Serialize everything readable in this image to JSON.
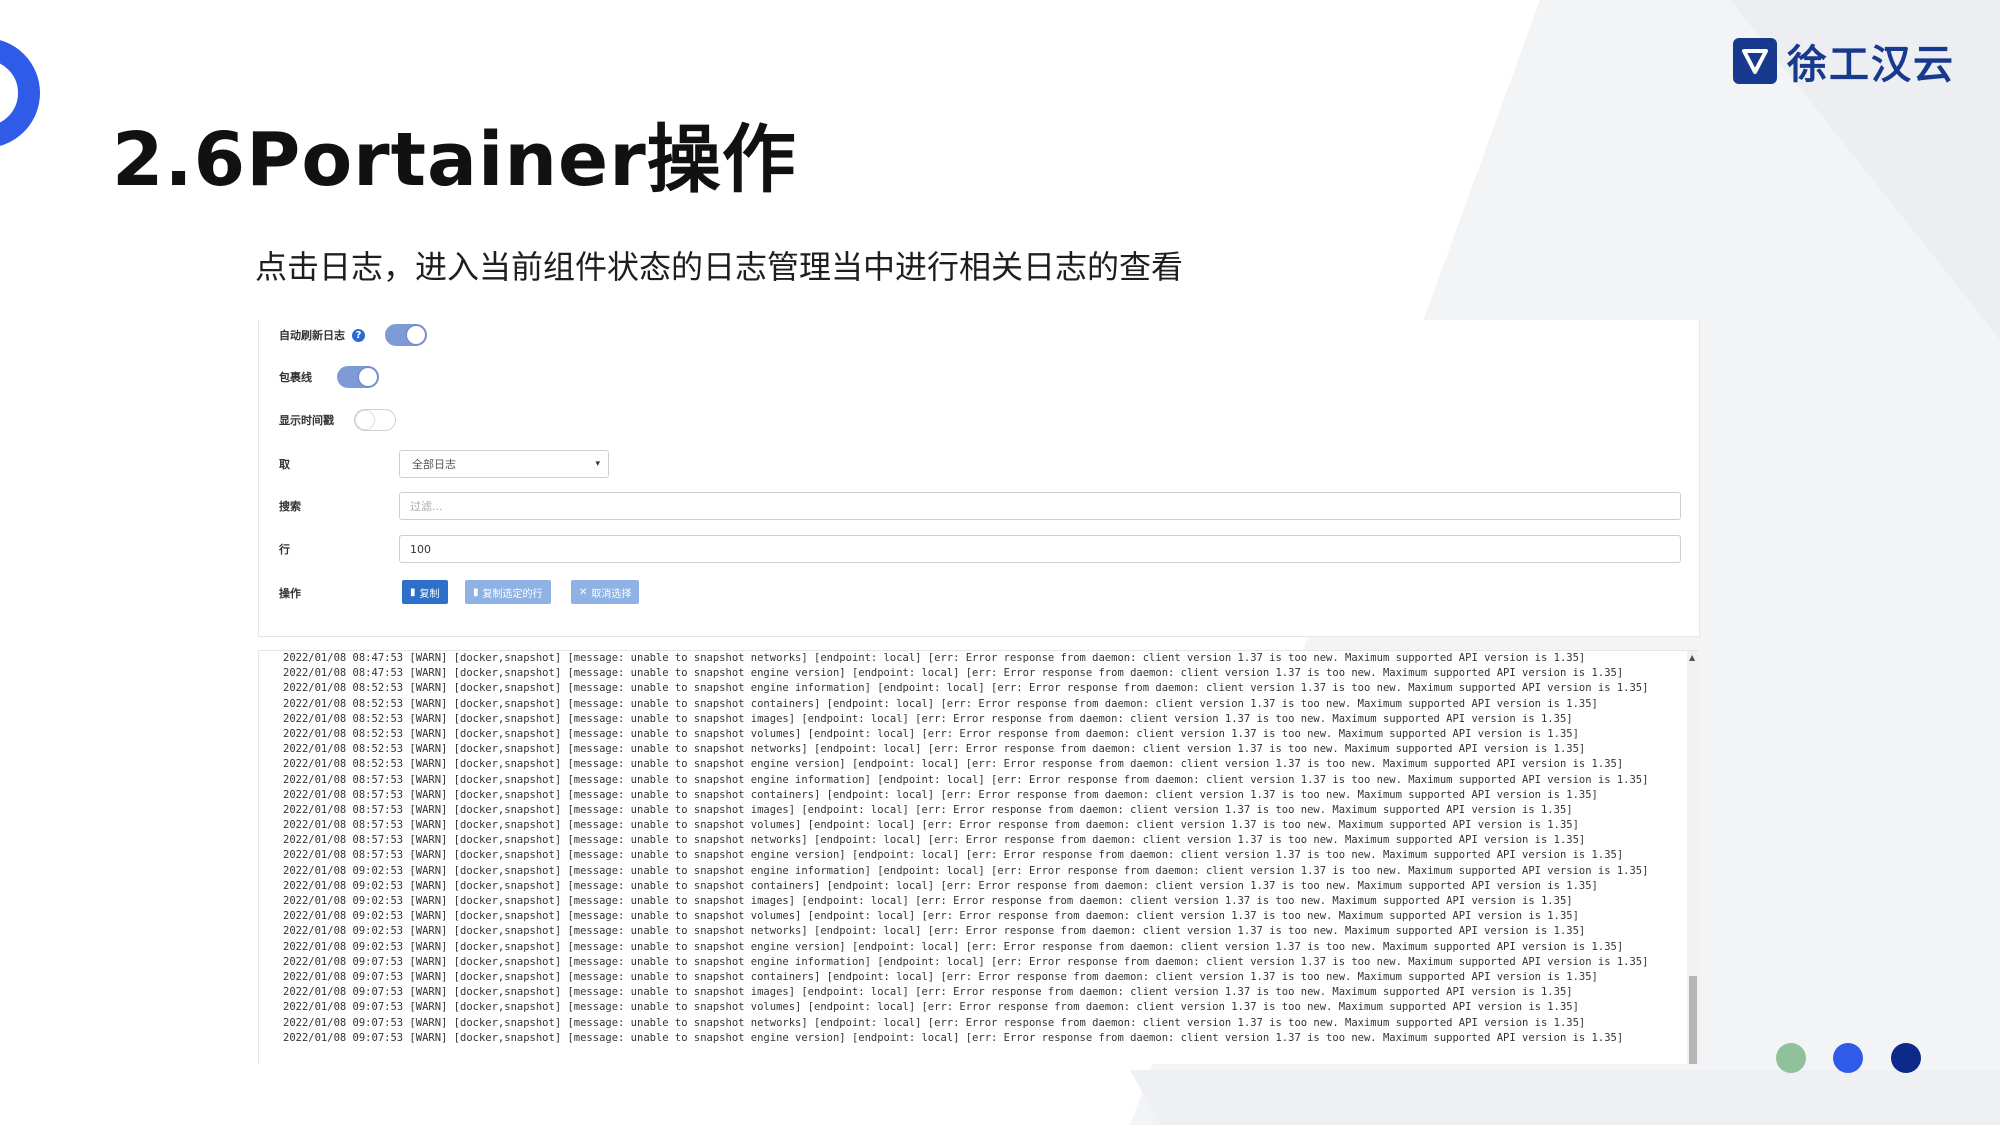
{
  "slide": {
    "title": "2.6Portainer操作",
    "subtitle": "点击日志，进入当前组件状态的日志管理当中进行相关日志的查看",
    "logo_text": "徐工汉云"
  },
  "colors": {
    "accent_blue": "#2f5be8",
    "logo_navy": "#173a8e",
    "dot_green": "#8fc29a",
    "dot_blue": "#2f5be8",
    "dot_navy": "#0d2a8a"
  },
  "form": {
    "auto_refresh_label": "自动刷新日志",
    "auto_refresh_on": true,
    "wrap_label": "包裹线",
    "wrap_on": true,
    "timestamp_label": "显示时间戳",
    "timestamp_on": false,
    "fetch_label": "取",
    "fetch_value": "全部日志",
    "search_label": "搜索",
    "search_placeholder": "过滤...",
    "lines_label": "行",
    "lines_value": "100",
    "actions_label": "操作",
    "copy_button": "复制",
    "copy_selected_button": "复制选定的行",
    "unselect_button": "取消选择"
  },
  "log_lines": [
    "2022/01/08 08:47:53 [WARN] [docker,snapshot] [message: unable to snapshot networks] [endpoint: local] [err: Error response from daemon: client version 1.37 is too new. Maximum supported API version is 1.35]",
    "2022/01/08 08:47:53 [WARN] [docker,snapshot] [message: unable to snapshot engine version] [endpoint: local] [err: Error response from daemon: client version 1.37 is too new. Maximum supported API version is 1.35]",
    "2022/01/08 08:52:53 [WARN] [docker,snapshot] [message: unable to snapshot engine information] [endpoint: local] [err: Error response from daemon: client version 1.37 is too new. Maximum supported API version is 1.35]",
    "2022/01/08 08:52:53 [WARN] [docker,snapshot] [message: unable to snapshot containers] [endpoint: local] [err: Error response from daemon: client version 1.37 is too new. Maximum supported API version is 1.35]",
    "2022/01/08 08:52:53 [WARN] [docker,snapshot] [message: unable to snapshot images] [endpoint: local] [err: Error response from daemon: client version 1.37 is too new. Maximum supported API version is 1.35]",
    "2022/01/08 08:52:53 [WARN] [docker,snapshot] [message: unable to snapshot volumes] [endpoint: local] [err: Error response from daemon: client version 1.37 is too new. Maximum supported API version is 1.35]",
    "2022/01/08 08:52:53 [WARN] [docker,snapshot] [message: unable to snapshot networks] [endpoint: local] [err: Error response from daemon: client version 1.37 is too new. Maximum supported API version is 1.35]",
    "2022/01/08 08:52:53 [WARN] [docker,snapshot] [message: unable to snapshot engine version] [endpoint: local] [err: Error response from daemon: client version 1.37 is too new. Maximum supported API version is 1.35]",
    "2022/01/08 08:57:53 [WARN] [docker,snapshot] [message: unable to snapshot engine information] [endpoint: local] [err: Error response from daemon: client version 1.37 is too new. Maximum supported API version is 1.35]",
    "2022/01/08 08:57:53 [WARN] [docker,snapshot] [message: unable to snapshot containers] [endpoint: local] [err: Error response from daemon: client version 1.37 is too new. Maximum supported API version is 1.35]",
    "2022/01/08 08:57:53 [WARN] [docker,snapshot] [message: unable to snapshot images] [endpoint: local] [err: Error response from daemon: client version 1.37 is too new. Maximum supported API version is 1.35]",
    "2022/01/08 08:57:53 [WARN] [docker,snapshot] [message: unable to snapshot volumes] [endpoint: local] [err: Error response from daemon: client version 1.37 is too new. Maximum supported API version is 1.35]",
    "2022/01/08 08:57:53 [WARN] [docker,snapshot] [message: unable to snapshot networks] [endpoint: local] [err: Error response from daemon: client version 1.37 is too new. Maximum supported API version is 1.35]",
    "2022/01/08 08:57:53 [WARN] [docker,snapshot] [message: unable to snapshot engine version] [endpoint: local] [err: Error response from daemon: client version 1.37 is too new. Maximum supported API version is 1.35]",
    "2022/01/08 09:02:53 [WARN] [docker,snapshot] [message: unable to snapshot engine information] [endpoint: local] [err: Error response from daemon: client version 1.37 is too new. Maximum supported API version is 1.35]",
    "2022/01/08 09:02:53 [WARN] [docker,snapshot] [message: unable to snapshot containers] [endpoint: local] [err: Error response from daemon: client version 1.37 is too new. Maximum supported API version is 1.35]",
    "2022/01/08 09:02:53 [WARN] [docker,snapshot] [message: unable to snapshot images] [endpoint: local] [err: Error response from daemon: client version 1.37 is too new. Maximum supported API version is 1.35]",
    "2022/01/08 09:02:53 [WARN] [docker,snapshot] [message: unable to snapshot volumes] [endpoint: local] [err: Error response from daemon: client version 1.37 is too new. Maximum supported API version is 1.35]",
    "2022/01/08 09:02:53 [WARN] [docker,snapshot] [message: unable to snapshot networks] [endpoint: local] [err: Error response from daemon: client version 1.37 is too new. Maximum supported API version is 1.35]",
    "2022/01/08 09:02:53 [WARN] [docker,snapshot] [message: unable to snapshot engine version] [endpoint: local] [err: Error response from daemon: client version 1.37 is too new. Maximum supported API version is 1.35]",
    "2022/01/08 09:07:53 [WARN] [docker,snapshot] [message: unable to snapshot engine information] [endpoint: local] [err: Error response from daemon: client version 1.37 is too new. Maximum supported API version is 1.35]",
    "2022/01/08 09:07:53 [WARN] [docker,snapshot] [message: unable to snapshot containers] [endpoint: local] [err: Error response from daemon: client version 1.37 is too new. Maximum supported API version is 1.35]",
    "2022/01/08 09:07:53 [WARN] [docker,snapshot] [message: unable to snapshot images] [endpoint: local] [err: Error response from daemon: client version 1.37 is too new. Maximum supported API version is 1.35]",
    "2022/01/08 09:07:53 [WARN] [docker,snapshot] [message: unable to snapshot volumes] [endpoint: local] [err: Error response from daemon: client version 1.37 is too new. Maximum supported API version is 1.35]",
    "2022/01/08 09:07:53 [WARN] [docker,snapshot] [message: unable to snapshot networks] [endpoint: local] [err: Error response from daemon: client version 1.37 is too new. Maximum supported API version is 1.35]",
    "2022/01/08 09:07:53 [WARN] [docker,snapshot] [message: unable to snapshot engine version] [endpoint: local] [err: Error response from daemon: client version 1.37 is too new. Maximum supported API version is 1.35]"
  ]
}
